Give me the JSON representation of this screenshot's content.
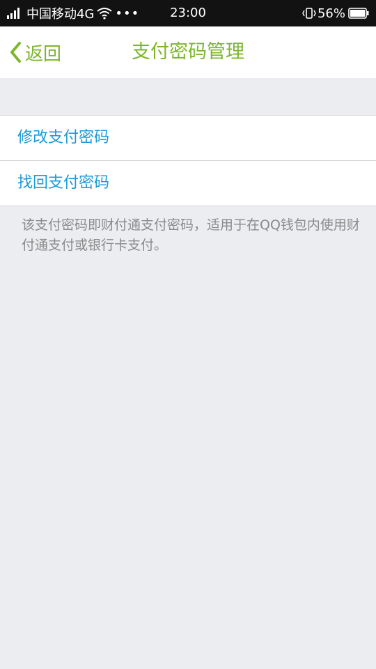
{
  "status_bar": {
    "carrier": "中国移动4G",
    "time": "23:00",
    "battery": "56%",
    "icons": [
      "signal-icon",
      "wifi-icon",
      "more-icon",
      "vibrate-icon",
      "battery-icon"
    ]
  },
  "nav": {
    "back_label": "返回",
    "title": "支付密码管理"
  },
  "menu": {
    "items": [
      {
        "label": "修改支付密码"
      },
      {
        "label": "找回支付密码"
      }
    ]
  },
  "hint": "该支付密码即财付通支付密码，适用于在QQ钱包内使用财付通支付或银行卡支付。",
  "colors": {
    "accent_green": "#7cb62c",
    "link_blue": "#1a9ad6",
    "background": "#ebedf1",
    "hint_gray": "#8a8a8a"
  }
}
